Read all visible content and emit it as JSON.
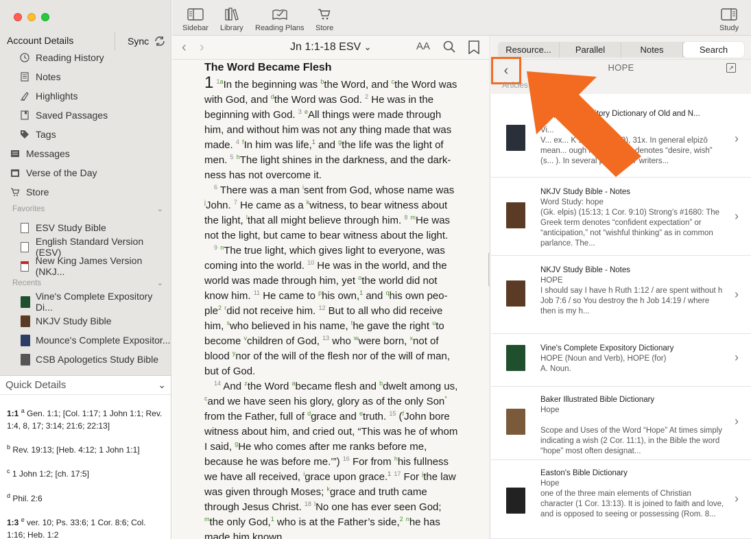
{
  "sidebar": {
    "account": "Account Details",
    "sync": "Sync",
    "items": [
      {
        "label": "Reading History",
        "icon": "clock-icon"
      },
      {
        "label": "Notes",
        "icon": "note-icon"
      },
      {
        "label": "Highlights",
        "icon": "highlighter-icon"
      },
      {
        "label": "Saved Passages",
        "icon": "saved-passage-icon"
      },
      {
        "label": "Tags",
        "icon": "tag-icon"
      },
      {
        "label": "Messages",
        "icon": "message-icon"
      },
      {
        "label": "Verse of the Day",
        "icon": "calendar-icon"
      },
      {
        "label": "Store",
        "icon": "cart-icon"
      }
    ],
    "favorites_label": "Favorites",
    "favorites": [
      "ESV Study Bible",
      "English Standard Version (ESV)",
      "New King James Version (NKJ..."
    ],
    "recents_label": "Recents",
    "recents": [
      "Vine's Complete Expository Di...",
      "NKJV Study Bible",
      "Mounce's Complete Expositor...",
      "CSB Apologetics Study Bible"
    ]
  },
  "quick_details": {
    "title": "Quick Details",
    "rows": [
      {
        "ref": "1:1",
        "mark": "a",
        "text": "Gen. 1:1; [Col. 1:17; 1 John 1:1; Rev. 1:4, 8, 17; 3:14; 21:6; 22:13]"
      },
      {
        "ref": "",
        "mark": "b",
        "text": "Rev. 19:13; [Heb. 4:12; 1 John 1:1]"
      },
      {
        "ref": "",
        "mark": "c",
        "text": "1 John 1:2; [ch. 17:5]"
      },
      {
        "ref": "",
        "mark": "d",
        "text": "Phil. 2:6"
      },
      {
        "ref": "1:3",
        "mark": "e",
        "text": "ver. 10; Ps. 33:6; 1 Cor. 8:6; Col. 1:16; Heb. 1:2"
      }
    ]
  },
  "toolbar": {
    "sidebar": "Sidebar",
    "library": "Library",
    "reading_plans": "Reading Plans",
    "store": "Store",
    "study": "Study"
  },
  "reader": {
    "reference": "Jn 1:1-18",
    "version": "ESV",
    "font_size": "AA",
    "heading": "The Word Became Flesh"
  },
  "right": {
    "tabs": [
      "Resource...",
      "Parallel",
      "Notes",
      "Search"
    ],
    "active_tab": "Search",
    "title": "HOPE",
    "section": "Articles",
    "results": [
      {
        "name": "...mplete Expository Dictionary of Old and N...",
        "sub": "Vi...",
        "snip": "V... ex... K 1827 (S 1679), 31x. In general elpizō mean... ough it sometimes denotes “desire, wish” (s... ). In several places, NT writers..."
      },
      {
        "name": "NKJV Study Bible - Notes",
        "sub": "Word Study: hope",
        "snip": "(Gk. elpis) (15:13; 1 Cor. 9:10) Strong’s #1680: The Greek term denotes “confident expectation” or “anticipation,” not “wishful thinking” as in common parlance. The..."
      },
      {
        "name": "NKJV Study Bible - Notes",
        "sub": "HOPE",
        "snip": "I should say I have h Ruth 1:12 / are spent without h Job 7:6 / so You destroy the h Job 14:19 / where then is my h..."
      },
      {
        "name": "Vine's Complete Expository Dictionary",
        "sub": "HOPE (Noun and Verb), HOPE (for)",
        "snip": "A. Noun."
      },
      {
        "name": "Baker Illustrated Bible Dictionary",
        "sub": "Hope",
        "snip": "Scope and Uses of the Word “Hope” At times simply indicating a wish (2 Cor. 11:1), in the Bible the word “hope” most often designat..."
      },
      {
        "name": "Easton's Bible Dictionary",
        "sub": "Hope",
        "snip": "one of the three main elements of Christian character (1 Cor. 13:13). It is joined to faith and love, and is opposed to seeing or possessing (Rom. 8..."
      }
    ]
  },
  "colors": {
    "callout": "#f26b21",
    "crossref": "#4a8b2c"
  }
}
